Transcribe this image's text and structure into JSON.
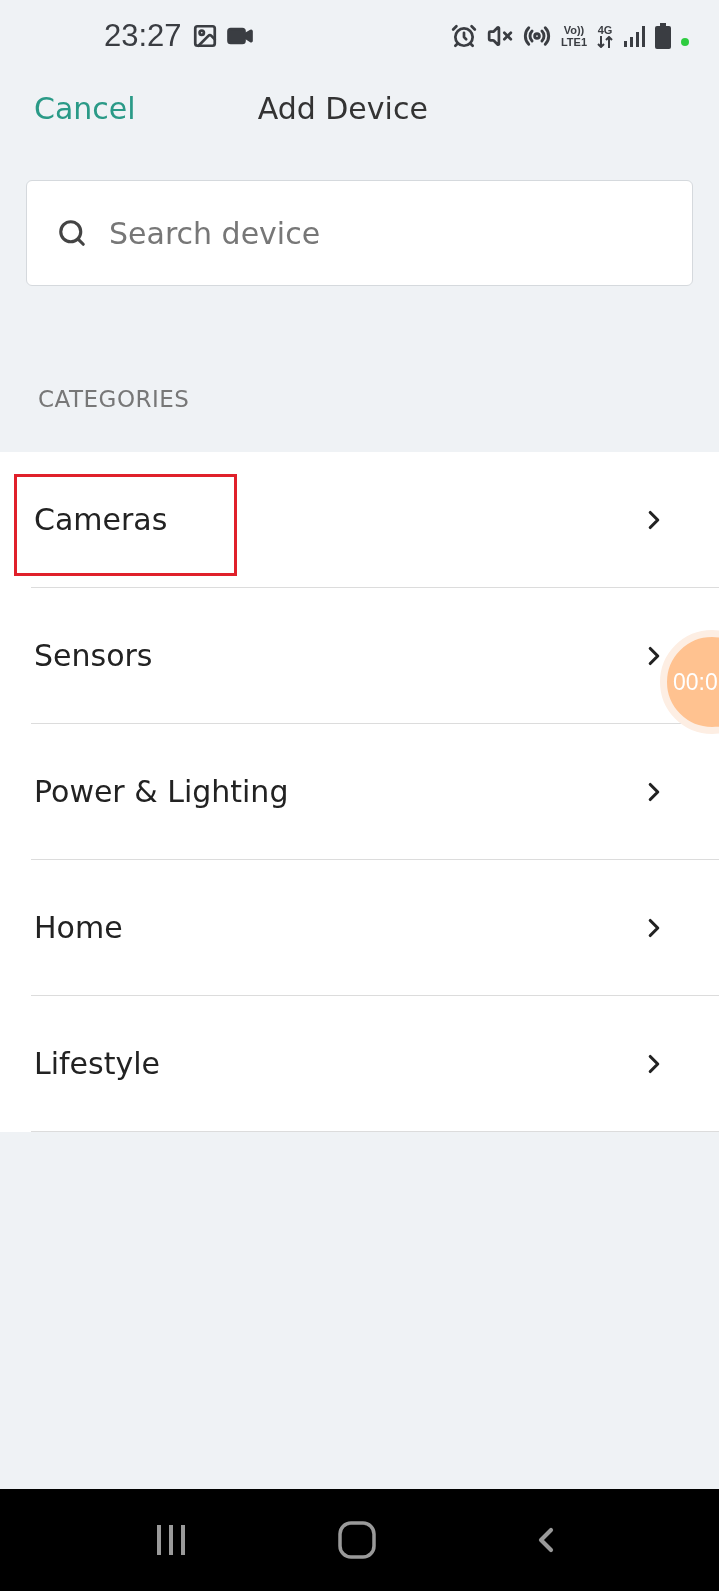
{
  "status_bar": {
    "time": "23:27",
    "volte": "Vo))",
    "lte": "LTE1",
    "network": "4G"
  },
  "header": {
    "cancel": "Cancel",
    "title": "Add Device"
  },
  "search": {
    "placeholder": "Search device"
  },
  "section_title": "CATEGORIES",
  "categories": [
    {
      "label": "Cameras",
      "highlighted": true
    },
    {
      "label": "Sensors",
      "highlighted": false
    },
    {
      "label": "Power & Lighting",
      "highlighted": false
    },
    {
      "label": "Home",
      "highlighted": false
    },
    {
      "label": "Lifestyle",
      "highlighted": false
    }
  ],
  "recording_badge": {
    "time": "00:0"
  }
}
